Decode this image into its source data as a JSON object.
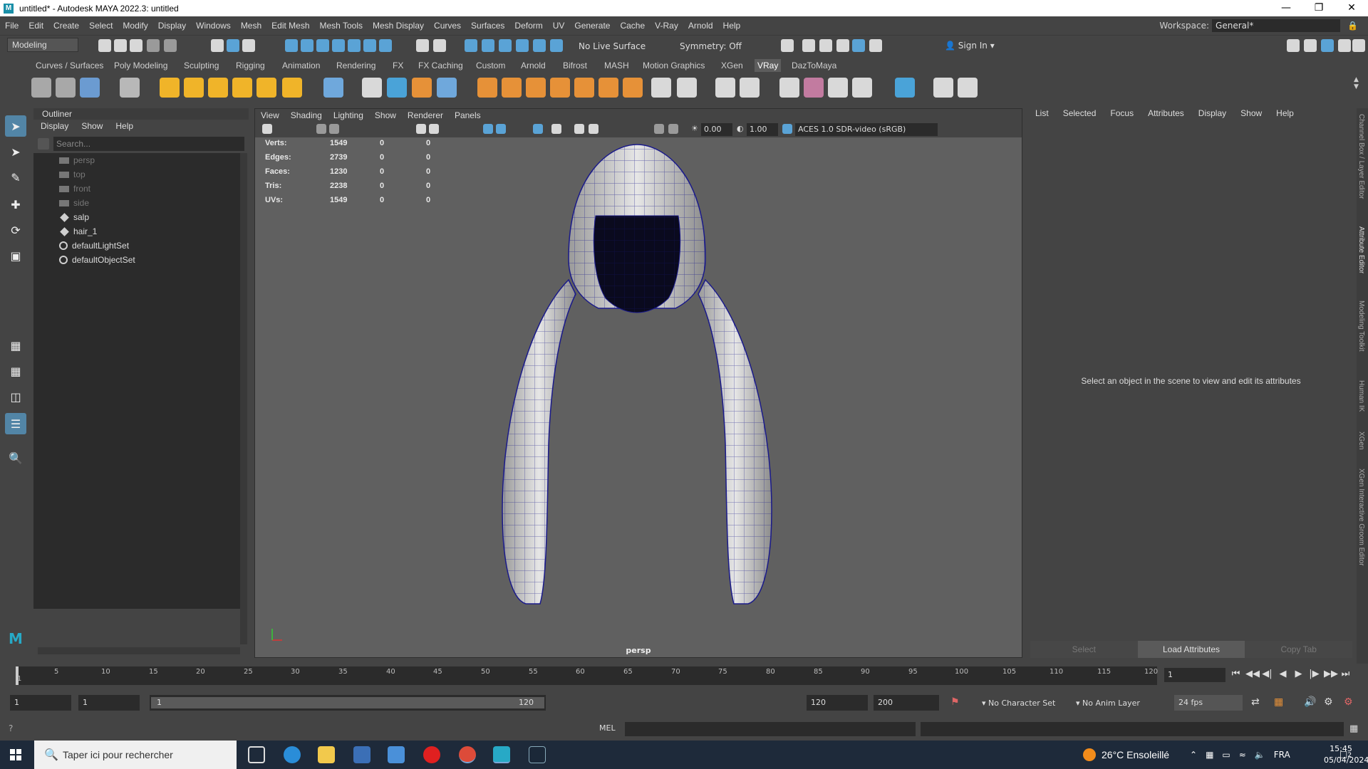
{
  "window": {
    "title": "untitled* - Autodesk MAYA 2022.3: untitled",
    "logo_letter": "M"
  },
  "menubar": {
    "items": [
      "File",
      "Edit",
      "Create",
      "Select",
      "Modify",
      "Display",
      "Windows",
      "Mesh",
      "Edit Mesh",
      "Mesh Tools",
      "Mesh Display",
      "Curves",
      "Surfaces",
      "Deform",
      "UV",
      "Generate",
      "Cache",
      "V-Ray",
      "Arnold",
      "Help"
    ]
  },
  "workspace": {
    "label": "Workspace:",
    "value": "General*"
  },
  "statusline": {
    "mode": "Modeling",
    "live_surface": "No Live Surface",
    "symmetry": "Symmetry: Off",
    "sign_in": "Sign In"
  },
  "shelf": {
    "tabs": [
      "Curves / Surfaces",
      "Poly Modeling",
      "Sculpting",
      "Rigging",
      "Animation",
      "Rendering",
      "FX",
      "FX Caching",
      "Custom",
      "Arnold",
      "Bifrost",
      "MASH",
      "Motion Graphics",
      "XGen",
      "VRay",
      "DazToMaya"
    ],
    "active_tab": "VRay"
  },
  "outliner": {
    "title": "Outliner",
    "menu": [
      "Display",
      "Show",
      "Help"
    ],
    "search_placeholder": "Search...",
    "items": [
      {
        "label": "persp",
        "kind": "camera",
        "dim": true
      },
      {
        "label": "top",
        "kind": "camera",
        "dim": true
      },
      {
        "label": "front",
        "kind": "camera",
        "dim": true
      },
      {
        "label": "side",
        "kind": "camera",
        "dim": true
      },
      {
        "label": "salp",
        "kind": "mesh",
        "dim": false
      },
      {
        "label": "hair_1",
        "kind": "mesh",
        "dim": false
      },
      {
        "label": "defaultLightSet",
        "kind": "set",
        "dim": false
      },
      {
        "label": "defaultObjectSet",
        "kind": "set",
        "dim": false
      }
    ]
  },
  "viewport": {
    "menu": [
      "View",
      "Shading",
      "Lighting",
      "Show",
      "Renderer",
      "Panels"
    ],
    "exposure": "0.00",
    "gamma": "1.00",
    "color_space": "ACES 1.0 SDR-video (sRGB)",
    "camera_label": "persp",
    "hud": [
      {
        "label": "Verts:",
        "v1": "1549",
        "v2": "0",
        "v3": "0"
      },
      {
        "label": "Edges:",
        "v1": "2739",
        "v2": "0",
        "v3": "0"
      },
      {
        "label": "Faces:",
        "v1": "1230",
        "v2": "0",
        "v3": "0"
      },
      {
        "label": "Tris:",
        "v1": "2238",
        "v2": "0",
        "v3": "0"
      },
      {
        "label": "UVs:",
        "v1": "1549",
        "v2": "0",
        "v3": "0"
      }
    ]
  },
  "attribute_editor": {
    "menu": [
      "List",
      "Selected",
      "Focus",
      "Attributes",
      "Display",
      "Show",
      "Help"
    ],
    "message": "Select an object in the scene to view and edit its attributes",
    "buttons": {
      "select": "Select",
      "load": "Load Attributes",
      "copy": "Copy Tab"
    }
  },
  "side_tabs": [
    "Channel Box / Layer Editor",
    "Attribute Editor",
    "Modeling Toolkit",
    "Human IK",
    "XGen",
    "XGen Interactive Groom Editor"
  ],
  "timeslider": {
    "ticks": [
      "1",
      "5",
      "10",
      "15",
      "20",
      "25",
      "30",
      "35",
      "40",
      "45",
      "50",
      "55",
      "60",
      "65",
      "70",
      "75",
      "80",
      "85",
      "90",
      "95",
      "100",
      "105",
      "110",
      "115",
      "120"
    ],
    "current_frame": "1"
  },
  "range": {
    "start": "1",
    "anim_start": "1",
    "range_start": "1",
    "range_end": "120",
    "end": "120",
    "anim_end": "200",
    "character_set": "No Character Set",
    "anim_layer": "No Anim Layer",
    "fps": "24 fps"
  },
  "cmdline": {
    "label": "MEL"
  },
  "taskbar": {
    "search_placeholder": "Taper ici pour rechercher",
    "weather": "26°C  Ensoleillé",
    "language": "FRA",
    "time": "15:45",
    "date": "05/04/2024",
    "notification_count": "2"
  },
  "colors": {
    "accent_blue": "#5285a6",
    "mesh_wire": "#1a1a8a",
    "background": "#444444"
  }
}
